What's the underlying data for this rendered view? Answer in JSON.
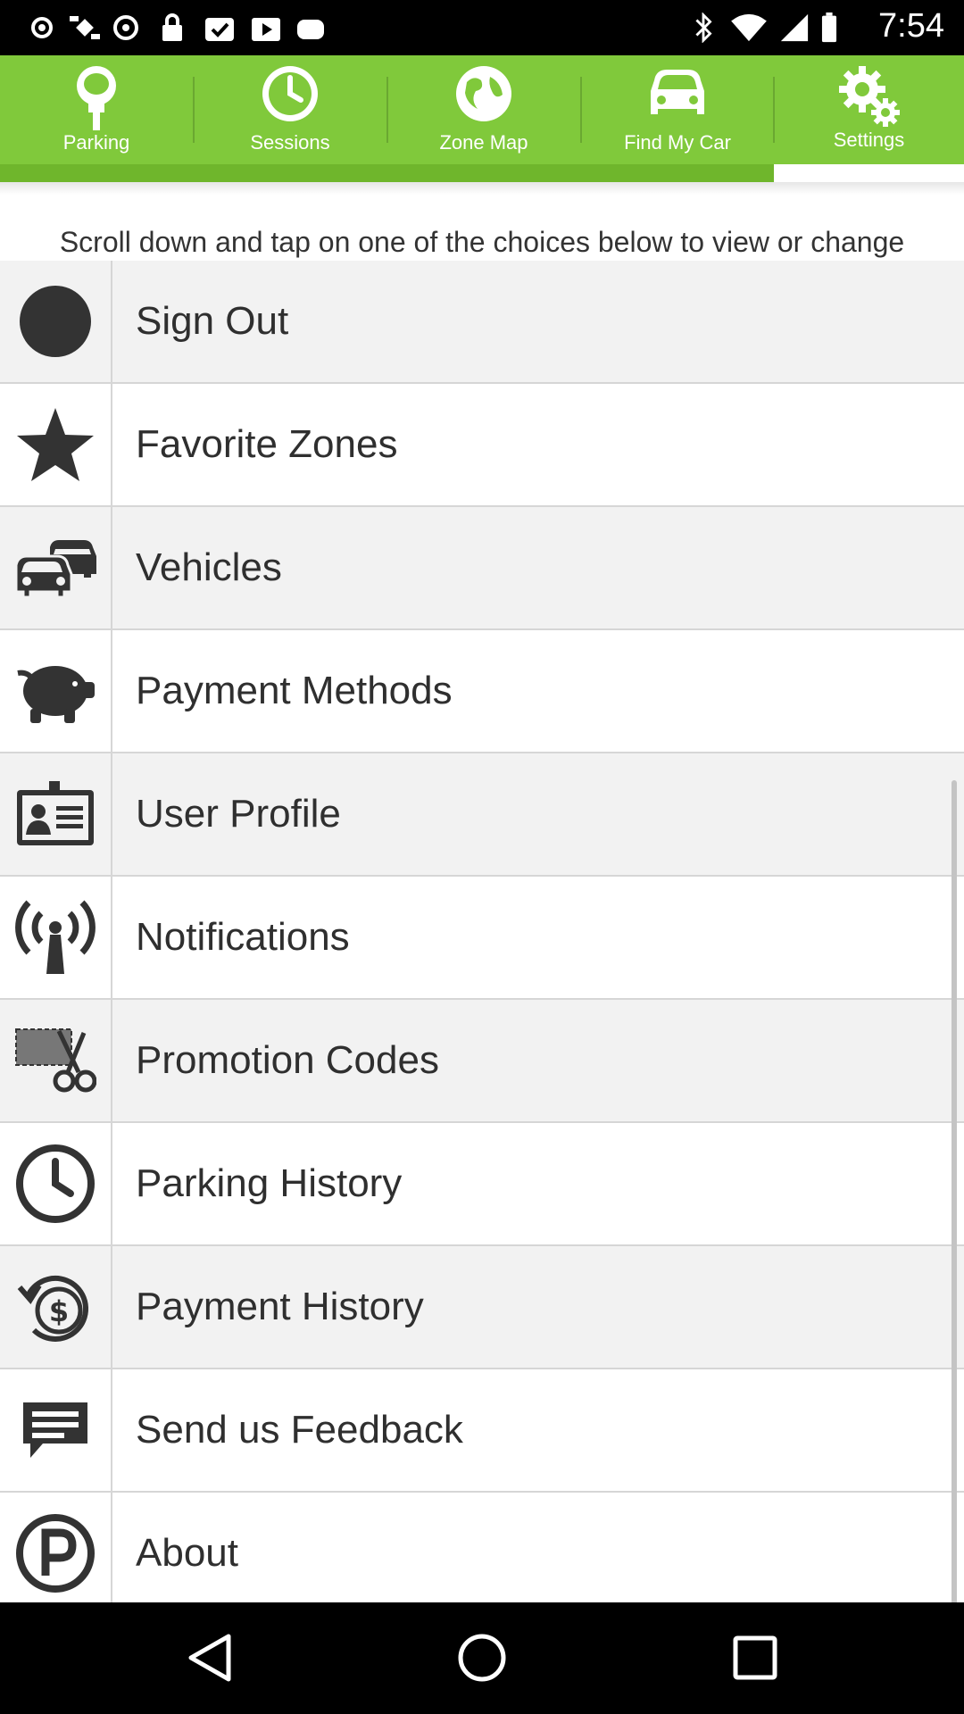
{
  "status_bar": {
    "time": "7:54",
    "icons": [
      "settings-notification-icon",
      "satellite-icon",
      "sync-icon",
      "lock-icon",
      "task-icon",
      "play-store-icon",
      "game-icon",
      "bluetooth-icon",
      "wifi-icon",
      "signal-icon",
      "battery-icon"
    ]
  },
  "tabs": [
    {
      "label": "Parking",
      "icon": "parking-meter-icon"
    },
    {
      "label": "Sessions",
      "icon": "clock-icon"
    },
    {
      "label": "Zone Map",
      "icon": "globe-icon"
    },
    {
      "label": "Find My Car",
      "icon": "car-icon"
    },
    {
      "label": "Settings",
      "icon": "gears-icon",
      "selected": true
    }
  ],
  "instructions": "Scroll down and tap on one of the choices below to view or change your settings.",
  "settings_items": [
    {
      "label": "Sign Out",
      "icon": "sign-out-icon"
    },
    {
      "label": "Favorite Zones",
      "icon": "star-icon"
    },
    {
      "label": "Vehicles",
      "icon": "vehicles-icon"
    },
    {
      "label": "Payment Methods",
      "icon": "piggy-bank-icon"
    },
    {
      "label": "User Profile",
      "icon": "id-card-icon"
    },
    {
      "label": "Notifications",
      "icon": "antenna-icon"
    },
    {
      "label": "Promotion Codes",
      "icon": "coupon-scissors-icon"
    },
    {
      "label": "Parking History",
      "icon": "clock-icon"
    },
    {
      "label": "Payment History",
      "icon": "dollar-history-icon"
    },
    {
      "label": "Send us Feedback",
      "icon": "chat-bubble-icon"
    },
    {
      "label": "About",
      "icon": "parking-logo-icon"
    }
  ],
  "colors": {
    "tab_bar": "#80c93b",
    "tab_underline": "#6fb62c",
    "selected_tab_underline": "#ffffff"
  }
}
